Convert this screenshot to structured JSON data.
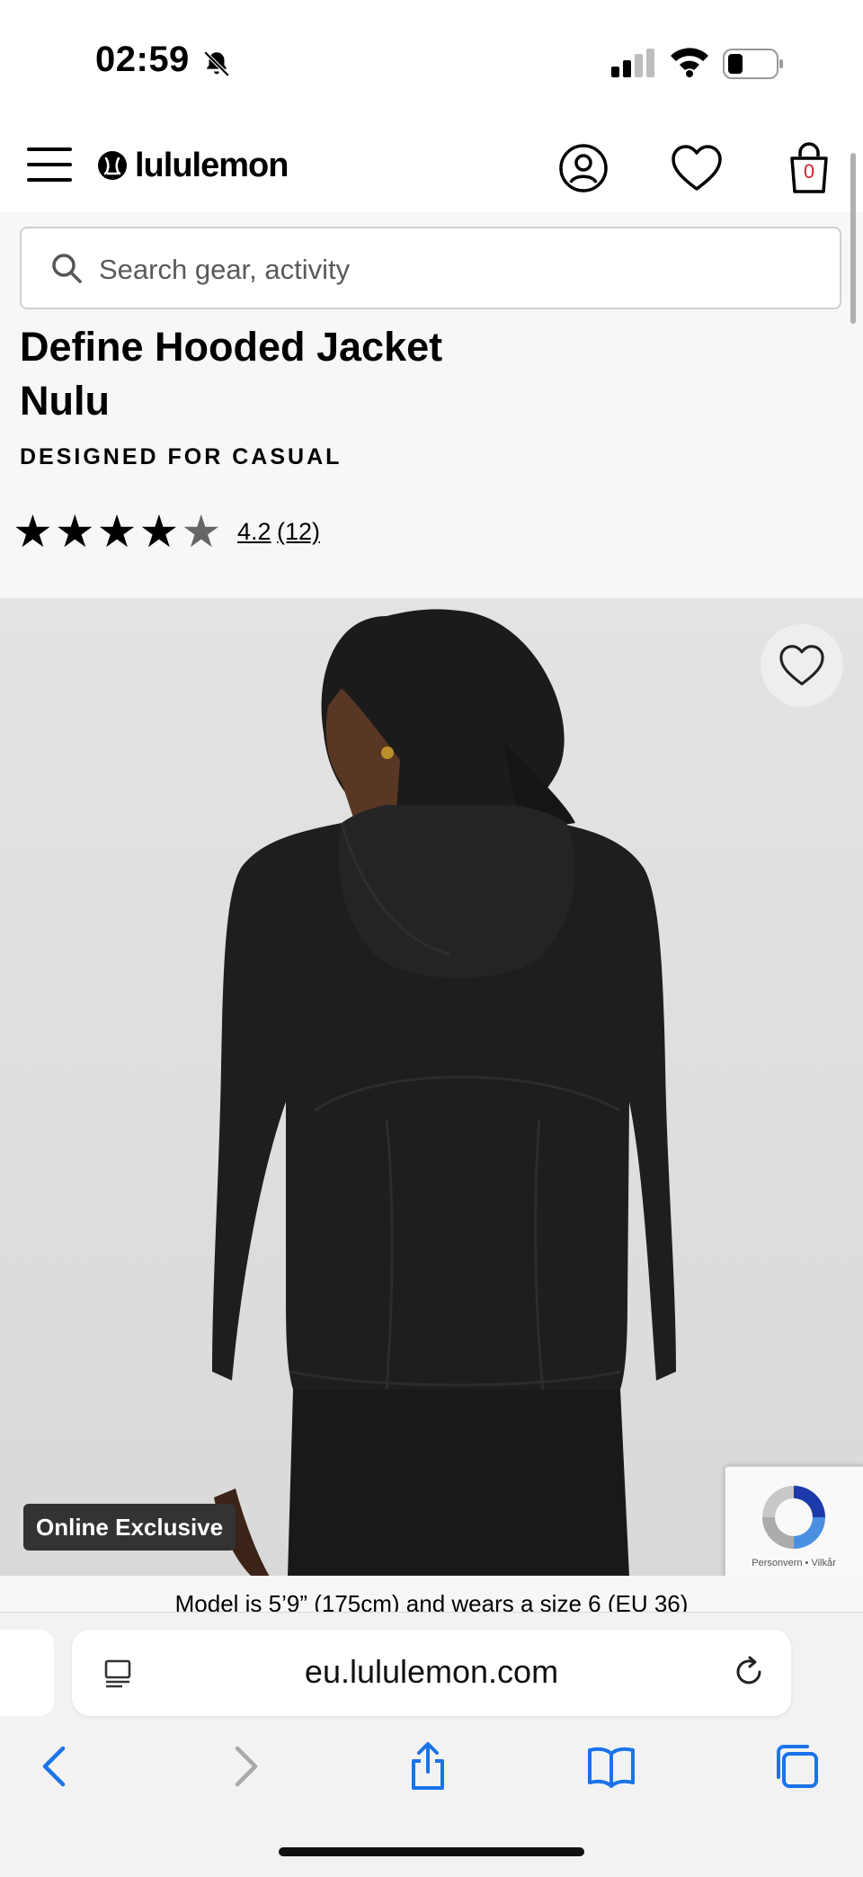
{
  "status_bar": {
    "time": "02:59"
  },
  "header": {
    "brand": "lululemon",
    "bag_count": "0"
  },
  "search": {
    "placeholder": "Search gear, activity"
  },
  "product": {
    "title": "Define Hooded Jacket Nulu",
    "designed_for": "DESIGNED FOR CASUAL",
    "rating_value": "4.2",
    "rating_count": "(12)",
    "rating": 4.2,
    "rating_max": 5
  },
  "gallery": {
    "badge": "Online Exclusive",
    "model_info": "Model is 5’9” (175cm) and wears a size 6 (EU 36)"
  },
  "recaptcha": {
    "text": "Personvern • Vilkår"
  },
  "browser": {
    "url": "eu.lululemon.com"
  },
  "colors": {
    "accent_red": "#d22030",
    "safari_blue": "#1a73e8"
  }
}
